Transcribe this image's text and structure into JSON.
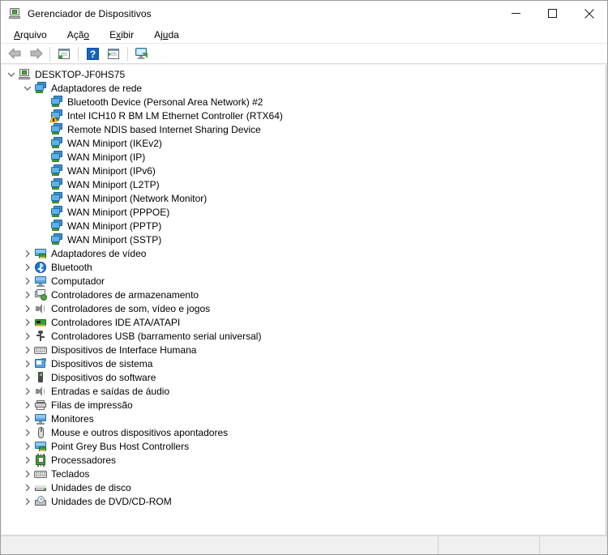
{
  "window": {
    "title": "Gerenciador de Dispositivos",
    "icon": "device-manager-icon",
    "minimize_label": "Minimizar",
    "maximize_label": "Maximizar",
    "close_label": "Fechar"
  },
  "menubar": {
    "items": [
      {
        "label": "Arquivo",
        "accel": "A",
        "name": "menu-arquivo"
      },
      {
        "label": "Ação",
        "accel": "o",
        "name": "menu-acao"
      },
      {
        "label": "Exibir",
        "accel": "x",
        "name": "menu-exibir"
      },
      {
        "label": "Ajuda",
        "accel": "u",
        "name": "menu-ajuda"
      }
    ]
  },
  "toolbar": {
    "buttons": [
      {
        "name": "back-button",
        "icon": "back-arrow-icon",
        "enabled": false
      },
      {
        "name": "forward-button",
        "icon": "forward-arrow-icon",
        "enabled": false
      },
      {
        "name": "separator-1",
        "icon": "separator"
      },
      {
        "name": "properties-button",
        "icon": "properties-icon",
        "enabled": true
      },
      {
        "name": "separator-2",
        "icon": "separator"
      },
      {
        "name": "help-button",
        "icon": "help-question-icon",
        "enabled": true
      },
      {
        "name": "scan-hardware-button",
        "icon": "scan-play-icon",
        "enabled": true
      },
      {
        "name": "separator-3",
        "icon": "separator"
      },
      {
        "name": "show-hidden-devices-button",
        "icon": "monitor-scan-icon",
        "enabled": true
      }
    ]
  },
  "tree": {
    "root": {
      "label": "DESKTOP-JF0HS75",
      "icon": "computer-icon",
      "expanded": true
    },
    "nodes": [
      {
        "label": "Adaptadores de rede",
        "icon": "network-adapter-icon",
        "level": 1,
        "state": "expanded"
      },
      {
        "label": "Bluetooth Device (Personal Area Network) #2",
        "icon": "network-adapter-icon",
        "level": 2,
        "state": "leaf"
      },
      {
        "label": "Intel ICH10 R BM LM Ethernet Controller (RTX64)",
        "icon": "network-adapter-warning-icon",
        "level": 2,
        "state": "leaf",
        "warning": true
      },
      {
        "label": "Remote NDIS based Internet Sharing Device",
        "icon": "network-adapter-icon",
        "level": 2,
        "state": "leaf"
      },
      {
        "label": "WAN Miniport (IKEv2)",
        "icon": "network-adapter-icon",
        "level": 2,
        "state": "leaf"
      },
      {
        "label": "WAN Miniport (IP)",
        "icon": "network-adapter-icon",
        "level": 2,
        "state": "leaf"
      },
      {
        "label": "WAN Miniport (IPv6)",
        "icon": "network-adapter-icon",
        "level": 2,
        "state": "leaf"
      },
      {
        "label": "WAN Miniport (L2TP)",
        "icon": "network-adapter-icon",
        "level": 2,
        "state": "leaf"
      },
      {
        "label": "WAN Miniport (Network Monitor)",
        "icon": "network-adapter-icon",
        "level": 2,
        "state": "leaf"
      },
      {
        "label": "WAN Miniport (PPPOE)",
        "icon": "network-adapter-icon",
        "level": 2,
        "state": "leaf"
      },
      {
        "label": "WAN Miniport (PPTP)",
        "icon": "network-adapter-icon",
        "level": 2,
        "state": "leaf"
      },
      {
        "label": "WAN Miniport (SSTP)",
        "icon": "network-adapter-icon",
        "level": 2,
        "state": "leaf"
      },
      {
        "label": "Adaptadores de vídeo",
        "icon": "display-adapter-icon",
        "level": 1,
        "state": "collapsed"
      },
      {
        "label": "Bluetooth",
        "icon": "bluetooth-icon",
        "level": 1,
        "state": "collapsed"
      },
      {
        "label": "Computador",
        "icon": "monitor-icon",
        "level": 1,
        "state": "collapsed"
      },
      {
        "label": "Controladores de armazenamento",
        "icon": "storage-controller-icon",
        "level": 1,
        "state": "collapsed"
      },
      {
        "label": "Controladores de som, vídeo e jogos",
        "icon": "speaker-icon",
        "level": 1,
        "state": "collapsed"
      },
      {
        "label": "Controladores IDE ATA/ATAPI",
        "icon": "ide-controller-icon",
        "level": 1,
        "state": "collapsed"
      },
      {
        "label": "Controladores USB (barramento serial universal)",
        "icon": "usb-icon",
        "level": 1,
        "state": "collapsed"
      },
      {
        "label": "Dispositivos de Interface Humana",
        "icon": "hid-keyboard-icon",
        "level": 1,
        "state": "collapsed"
      },
      {
        "label": "Dispositivos de sistema",
        "icon": "system-device-icon",
        "level": 1,
        "state": "collapsed"
      },
      {
        "label": "Dispositivos do software",
        "icon": "software-device-icon",
        "level": 1,
        "state": "collapsed"
      },
      {
        "label": "Entradas e saídas de áudio",
        "icon": "speaker-icon",
        "level": 1,
        "state": "collapsed"
      },
      {
        "label": "Filas de impressão",
        "icon": "printer-icon",
        "level": 1,
        "state": "collapsed"
      },
      {
        "label": "Monitores",
        "icon": "monitor-icon",
        "level": 1,
        "state": "collapsed"
      },
      {
        "label": "Mouse e outros dispositivos apontadores",
        "icon": "mouse-icon",
        "level": 1,
        "state": "collapsed"
      },
      {
        "label": "Point Grey Bus Host Controllers",
        "icon": "display-adapter-icon",
        "level": 1,
        "state": "collapsed"
      },
      {
        "label": "Processadores",
        "icon": "processor-icon",
        "level": 1,
        "state": "collapsed"
      },
      {
        "label": "Teclados",
        "icon": "hid-keyboard-icon",
        "level": 1,
        "state": "collapsed"
      },
      {
        "label": "Unidades de disco",
        "icon": "disk-drive-icon",
        "level": 1,
        "state": "collapsed"
      },
      {
        "label": "Unidades de DVD/CD-ROM",
        "icon": "dvd-drive-icon",
        "level": 1,
        "state": "collapsed"
      }
    ]
  },
  "statusbar": {
    "panes": [
      "",
      "",
      ""
    ]
  },
  "colors": {
    "window_bg": "#f0f0f0",
    "content_bg": "#ffffff",
    "text": "#000000",
    "accent_blue": "#59a7e0",
    "warning_amber": "#f0b323",
    "green": "#4aa83c"
  }
}
